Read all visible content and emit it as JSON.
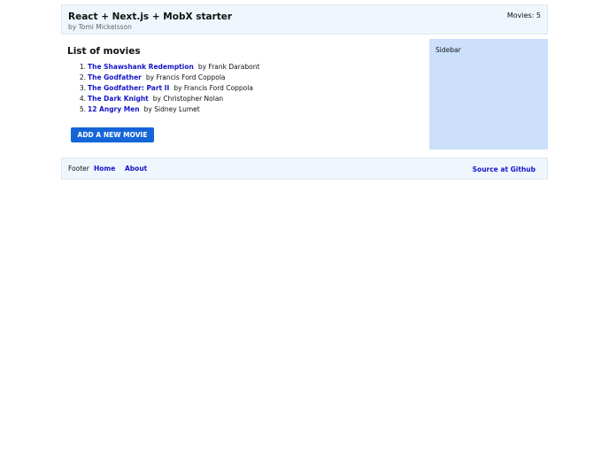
{
  "header": {
    "title": "React + Next.js + MobX starter",
    "byline": "by Tomi Mickelsson",
    "movie_count": "Movies: 5"
  },
  "main": {
    "heading": "List of movies",
    "movies": [
      {
        "num": "1.",
        "title": "The Shawshank Redemption",
        "director": "by Frank Darabont"
      },
      {
        "num": "2.",
        "title": "The Godfather",
        "director": "by Francis Ford Coppola"
      },
      {
        "num": "3.",
        "title": "The Godfather: Part II",
        "director": "by Francis Ford Coppola"
      },
      {
        "num": "4.",
        "title": "The Dark Knight",
        "director": "by Christopher Nolan"
      },
      {
        "num": "5.",
        "title": "12 Angry Men",
        "director": "by Sidney Lumet"
      }
    ],
    "add_button": "ADD A NEW MOVIE"
  },
  "sidebar": {
    "label": "Sidebar"
  },
  "footer": {
    "label": "Footer",
    "home": "Home",
    "about": "About",
    "source": "Source at Github"
  }
}
